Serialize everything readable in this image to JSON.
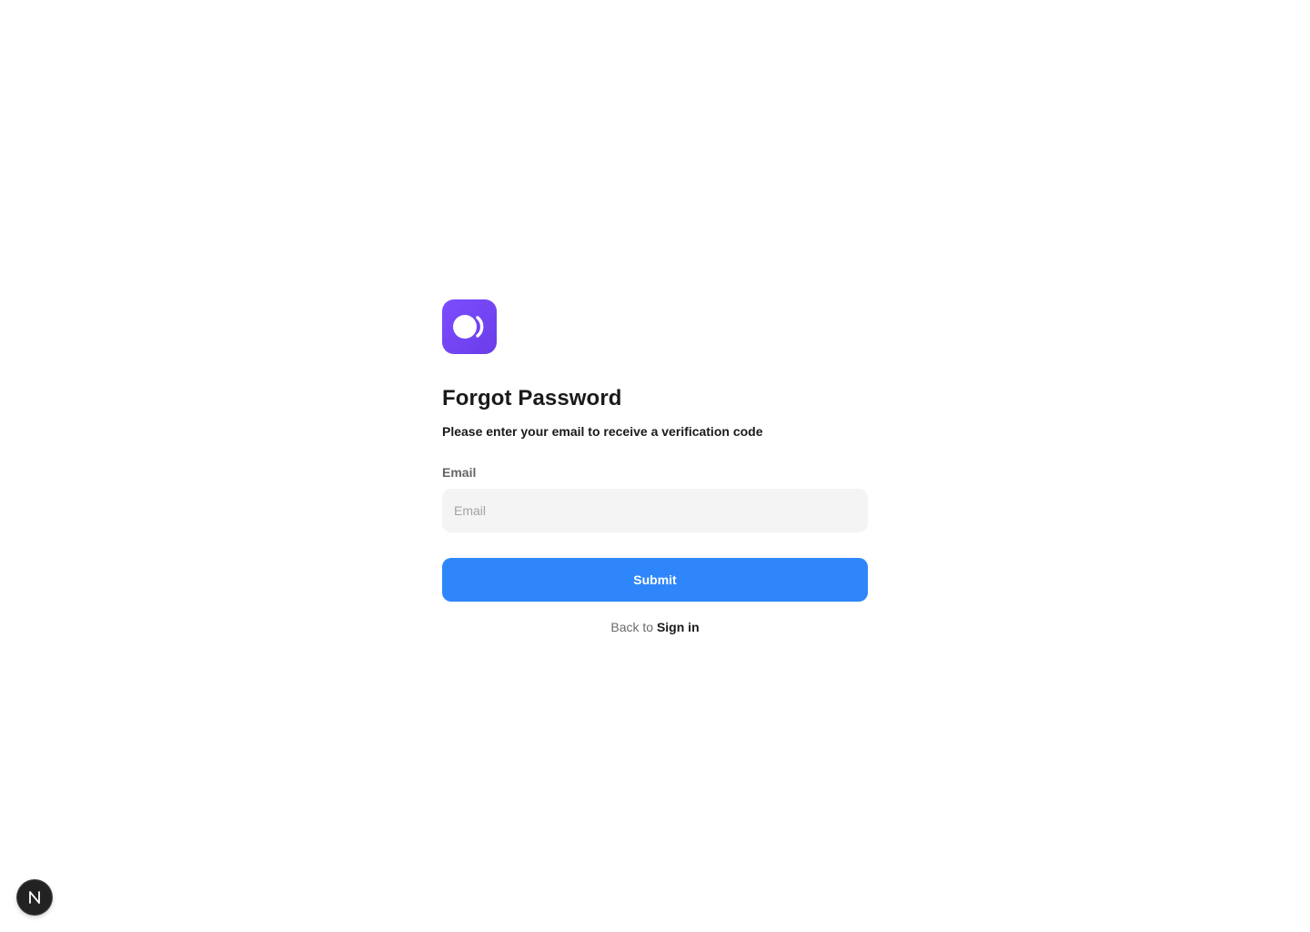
{
  "logo": {
    "icon": "app-logo-icon",
    "color": "#7248f0"
  },
  "header": {
    "title": "Forgot Password",
    "subtitle": "Please enter your email to receive a verification code"
  },
  "form": {
    "email_label": "Email",
    "email_placeholder": "Email",
    "email_value": "",
    "submit_label": "Submit"
  },
  "footer": {
    "back_text": "Back to",
    "signin_link": "Sign in"
  },
  "dev_indicator": {
    "icon": "nextjs-n-icon",
    "letter": "N"
  },
  "colors": {
    "accent": "#2f86fb",
    "brand": "#7248f0",
    "input_bg": "#f4f4f4"
  }
}
